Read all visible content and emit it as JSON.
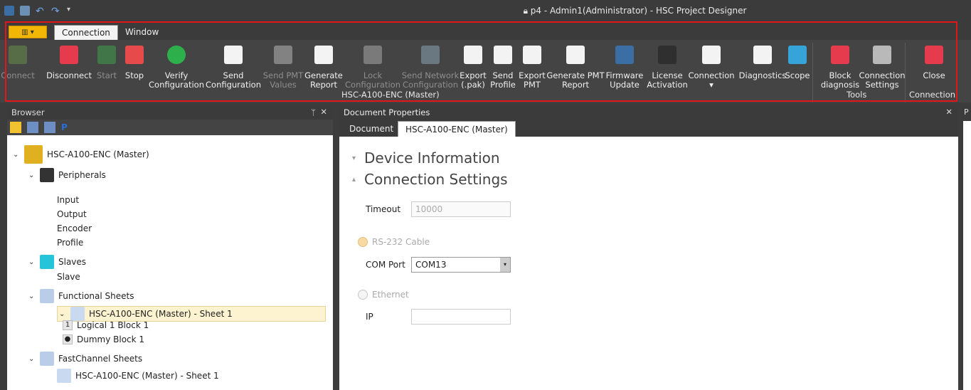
{
  "window": {
    "title": "p4 - Admin1(Administrator) - HSC Project Designer"
  },
  "tabs": [
    "Connection",
    "Window"
  ],
  "ribbon": {
    "buttons": [
      {
        "label": "Connect",
        "disabled": true,
        "icon": "plug-connect-icon"
      },
      {
        "label": "Disconnect",
        "disabled": false,
        "icon": "plug-disconnect-icon"
      },
      {
        "label": "Start",
        "disabled": true,
        "icon": "play-icon"
      },
      {
        "label": "Stop",
        "disabled": false,
        "icon": "stop-icon"
      },
      {
        "label": "Verify\nConfiguration",
        "disabled": false,
        "icon": "check-badge-icon"
      },
      {
        "label": "Send\nConfiguration",
        "disabled": false,
        "icon": "send-document-icon"
      },
      {
        "label": "Send PMT\nValues",
        "disabled": true,
        "icon": "send-pmt-icon"
      },
      {
        "label": "Generate\nReport",
        "disabled": false,
        "icon": "report-icon"
      },
      {
        "label": "Lock\nConfiguration",
        "disabled": true,
        "icon": "lock-icon"
      },
      {
        "label": "Send Network\nConfiguration",
        "disabled": true,
        "icon": "network-icon"
      },
      {
        "label": "Export\n(.pak)",
        "disabled": false,
        "icon": "barcode-icon"
      },
      {
        "label": "Send\nProfile",
        "disabled": false,
        "icon": "send-profile-icon"
      },
      {
        "label": "Export\nPMT",
        "disabled": false,
        "icon": "sliders-icon"
      },
      {
        "label": "Generate PMT\nReport",
        "disabled": false,
        "icon": "pmt-report-icon"
      },
      {
        "label": "Firmware\nUpdate",
        "disabled": false,
        "icon": "chip-icon"
      },
      {
        "label": "License\nActivation",
        "disabled": false,
        "icon": "key-icon"
      },
      {
        "label": "Connection\n▾",
        "disabled": false,
        "icon": "page-icon"
      },
      {
        "label": "Diagnostics",
        "disabled": false,
        "icon": "diagnostics-icon"
      },
      {
        "label": "Scope",
        "disabled": false,
        "icon": "scope-icon"
      },
      {
        "label": "Block\ndiagnosis",
        "disabled": false,
        "icon": "medical-icon"
      },
      {
        "label": "Connection\nSettings",
        "disabled": false,
        "icon": "wrench-icon"
      },
      {
        "label": "Close",
        "disabled": false,
        "icon": "close-red-icon"
      }
    ],
    "groups": [
      "HSC-A100-ENC (Master)",
      "Tools",
      "Connection"
    ]
  },
  "browser": {
    "title": "Browser",
    "tree": [
      {
        "label": "HSC-A100-ENC (Master)",
        "level": 0,
        "chev": true,
        "icon": "device-icon"
      },
      {
        "label": "Peripherals",
        "level": 1,
        "chev": true,
        "icon": "gear-icon"
      },
      {
        "label": "Input",
        "level": 2,
        "chev": false
      },
      {
        "label": "Output",
        "level": 2,
        "chev": false
      },
      {
        "label": "Encoder",
        "level": 2,
        "chev": false
      },
      {
        "label": "Profile",
        "level": 2,
        "chev": false
      },
      {
        "label": "Slaves",
        "level": 1,
        "chev": true,
        "icon": "slaves-icon"
      },
      {
        "label": "Slave",
        "level": 2,
        "chev": false
      },
      {
        "label": "Functional Sheets",
        "level": 1,
        "chev": true,
        "icon": "sheets-icon"
      },
      {
        "label": "HSC-A100-ENC (Master) - Sheet 1",
        "level": 2,
        "chev": true,
        "icon": "sheet-icon",
        "selected": true
      },
      {
        "label": "Logical 1 Block 1",
        "level": 3,
        "chev": false,
        "badge": "1"
      },
      {
        "label": "Dummy Block 1",
        "level": 3,
        "chev": false,
        "badge": "●"
      },
      {
        "label": "FastChannel Sheets",
        "level": 1,
        "chev": true,
        "icon": "sheets-icon"
      },
      {
        "label": "HSC-A100-ENC (Master) - Sheet 1",
        "level": 2,
        "chev": false,
        "icon": "sheet-icon"
      }
    ]
  },
  "document": {
    "title": "Document Properties",
    "tabs": [
      "Document",
      "HSC-A100-ENC (Master)"
    ],
    "sections": [
      "Device Information",
      "Connection Settings"
    ],
    "timeout_label": "Timeout",
    "timeout_value": "10000",
    "rs232_label": "RS-232 Cable",
    "com_label": "COM Port",
    "com_value": "COM13",
    "ethernet_label": "Ethernet",
    "ip_label": "IP",
    "ip_value": ""
  },
  "right_panel": {
    "title": "P"
  }
}
